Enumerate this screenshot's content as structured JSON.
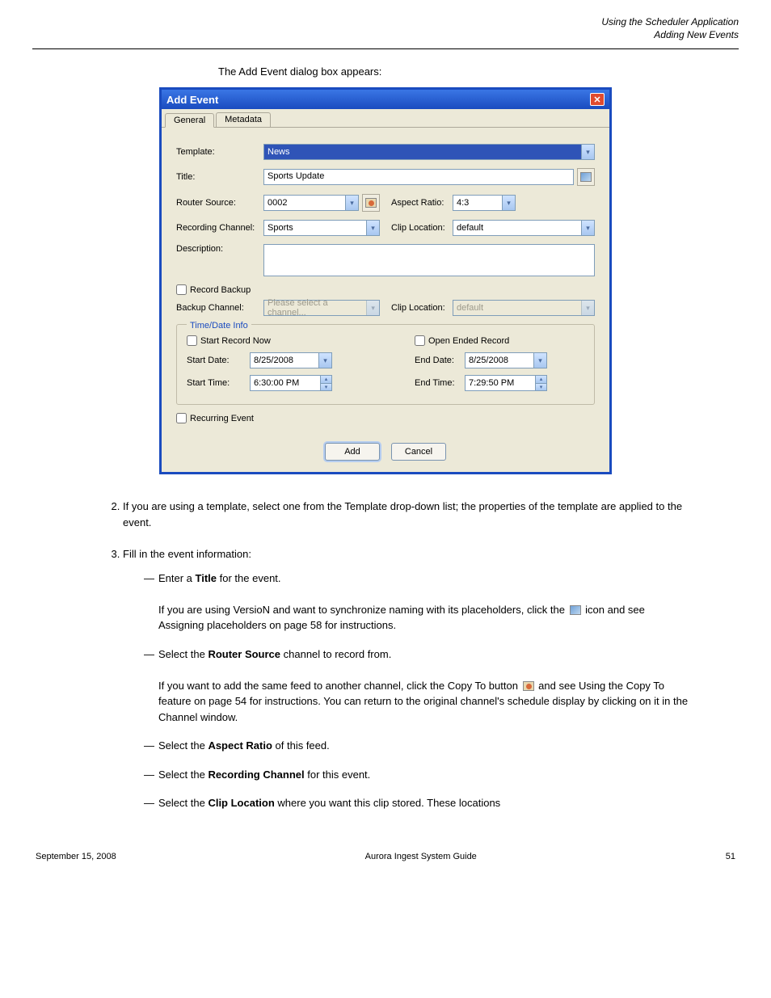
{
  "header": {
    "doc_title": "Using the Scheduler Application",
    "section": "Adding New Events"
  },
  "dialog_note": "The Add Event dialog box appears:",
  "dialog": {
    "title": "Add Event",
    "tabs": {
      "general": "General",
      "metadata": "Metadata"
    },
    "labels": {
      "template": "Template:",
      "title": "Title:",
      "router_source": "Router Source:",
      "aspect_ratio": "Aspect Ratio:",
      "recording_channel": "Recording Channel:",
      "clip_location": "Clip Location:",
      "description": "Description:",
      "record_backup": "Record Backup",
      "backup_channel": "Backup Channel:",
      "clip_location2": "Clip Location:",
      "time_date": "Time/Date Info",
      "start_record_now": "Start Record Now",
      "open_ended": "Open Ended Record",
      "start_date": "Start Date:",
      "end_date": "End Date:",
      "start_time": "Start Time:",
      "end_time": "End Time:",
      "recurring": "Recurring Event"
    },
    "values": {
      "template": "News",
      "title": "Sports Update",
      "router_source": "0002",
      "aspect_ratio": "4:3",
      "recording_channel": "Sports",
      "clip_location": "default",
      "description": "",
      "backup_channel": "Please select a channel...",
      "clip_location2": "default",
      "start_date": "8/25/2008",
      "end_date": "8/25/2008",
      "start_time": "6:30:00 PM",
      "end_time": "7:29:50 PM"
    },
    "buttons": {
      "add": "Add",
      "cancel": "Cancel"
    }
  },
  "steps": {
    "s2": "If you are using a template, select one from the Template drop-down list; the properties of the template are applied to the event.",
    "s3": "Fill in the event information:",
    "sub": {
      "a_pre": "Enter a ",
      "a_bold": "Title",
      "a_post": " for the event.",
      "a_2": "If you are using VersioN and want to synchronize naming with its placeholders, click the ",
      "a_3": " icon and see Assigning placeholders on page 58 for instructions.",
      "b_pre": "Select the ",
      "b_bold": "Router Source",
      "b_post": " channel to record from.",
      "b_2": "If you want to add the same feed to another channel, click the Copy To button ",
      "b_3": " and see Using the Copy To feature on page 54 for instructions. You can return to the original channel's schedule display by clicking on it in the Channel window.",
      "c_pre": "Select the ",
      "c_bold": "Aspect Ratio",
      "c_post": " of this feed.",
      "d_pre": "Select the ",
      "d_bold": "Recording Channel",
      "d_post": " for this event.",
      "e_pre": "Select the ",
      "e_bold": "Clip Location",
      "e_post": " where you want this clip stored. These locations"
    }
  },
  "footer": {
    "left": "September 15, 2008",
    "center": "Aurora Ingest System Guide",
    "right": "51"
  }
}
